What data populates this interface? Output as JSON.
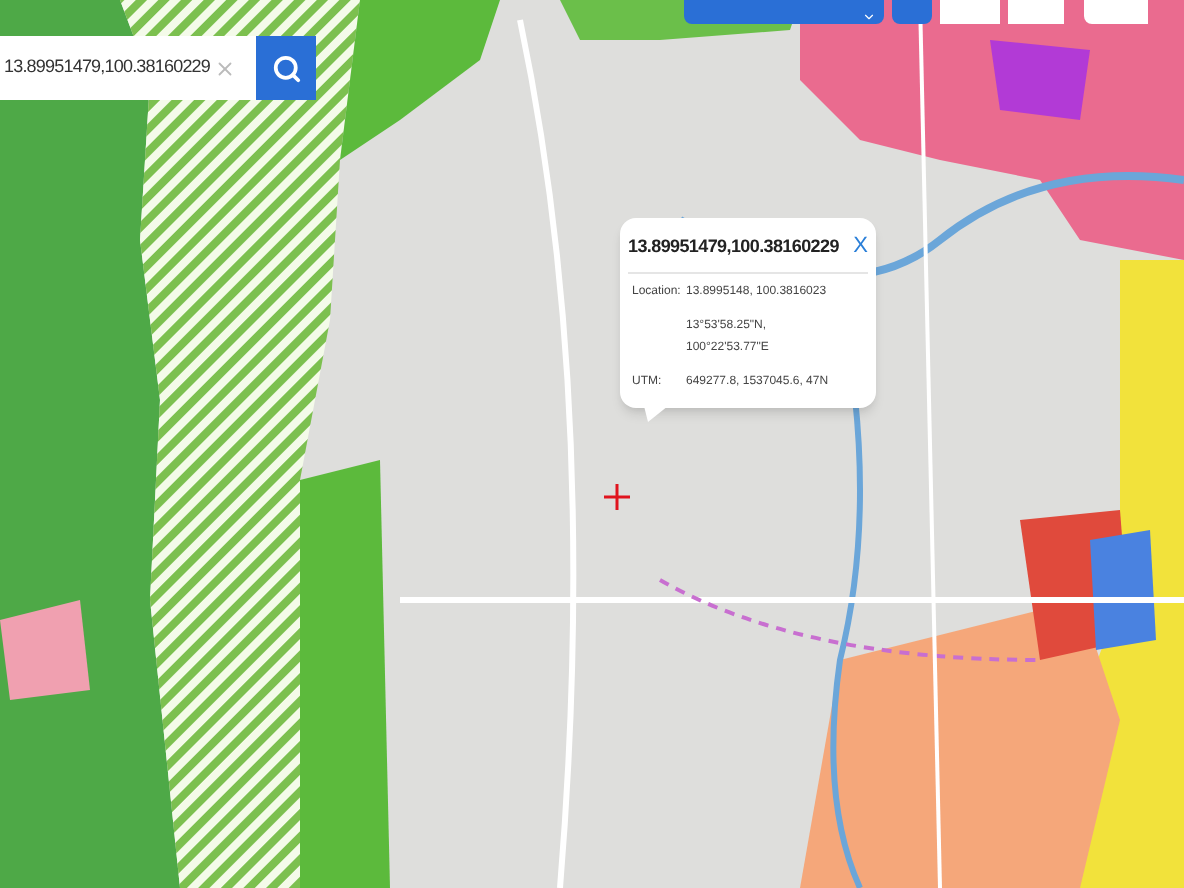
{
  "search": {
    "value": "13.89951479,100.38160229"
  },
  "popup": {
    "title": "13.89951479,100.38160229",
    "close": "X",
    "rows": [
      {
        "label": "Location:",
        "lines": [
          "13.8995148, 100.3816023"
        ]
      },
      {
        "lines": [
          "13°53'58.25\"N,",
          "100°22'53.77\"E"
        ]
      },
      {
        "label": "UTM:",
        "lines": [
          "649277.8, 1537045.6, 47N"
        ]
      }
    ]
  }
}
